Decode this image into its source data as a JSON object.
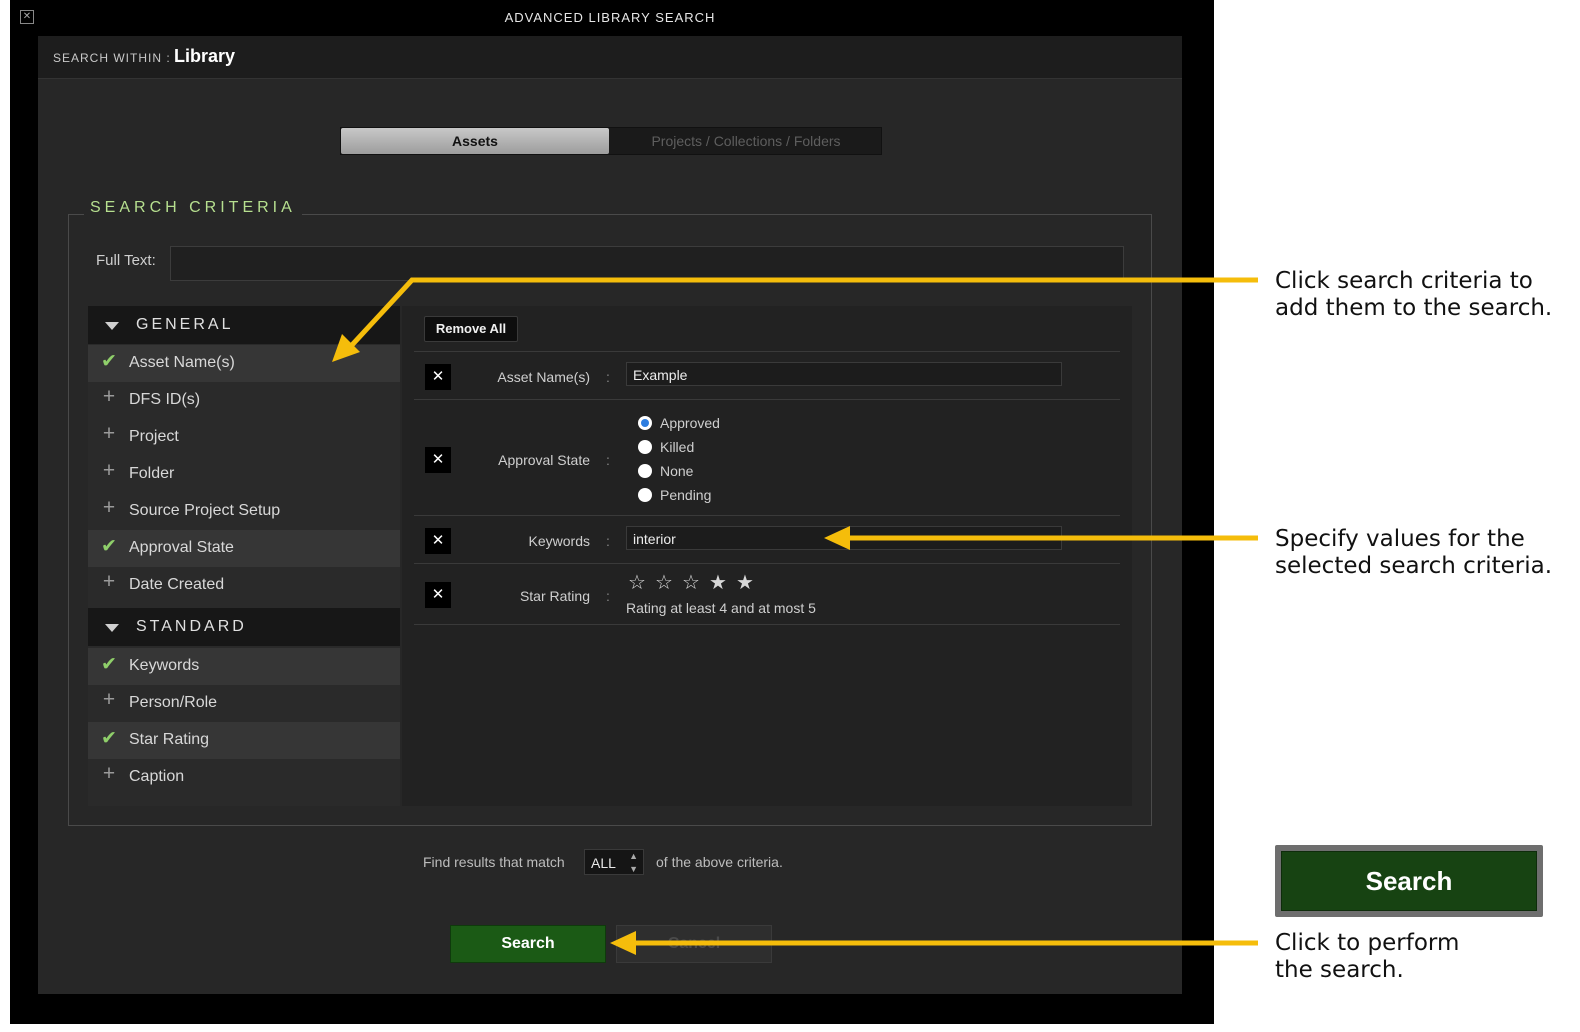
{
  "window": {
    "title": "ADVANCED LIBRARY SEARCH",
    "close_icon": "close-icon"
  },
  "search_within": {
    "label": "SEARCH WITHIN :",
    "value": "Library"
  },
  "tabs": [
    {
      "label": "Assets",
      "active": true
    },
    {
      "label": "Projects / Collections / Folders",
      "active": false
    }
  ],
  "criteria": {
    "title": "SEARCH CRITERIA",
    "full_text_label": "Full Text:",
    "full_text_value": "",
    "groups": [
      {
        "label": "GENERAL",
        "items": [
          {
            "label": "Asset Name(s)",
            "selected": true
          },
          {
            "label": "DFS ID(s)",
            "selected": false
          },
          {
            "label": "Project",
            "selected": false
          },
          {
            "label": "Folder",
            "selected": false
          },
          {
            "label": "Source Project Setup",
            "selected": false
          },
          {
            "label": "Approval State",
            "selected": true
          },
          {
            "label": "Date Created",
            "selected": false
          }
        ]
      },
      {
        "label": "STANDARD",
        "items": [
          {
            "label": "Keywords",
            "selected": true
          },
          {
            "label": "Person/Role",
            "selected": false
          },
          {
            "label": "Star Rating",
            "selected": true
          },
          {
            "label": "Caption",
            "selected": false
          }
        ]
      }
    ]
  },
  "selected_panel": {
    "remove_all": "Remove All",
    "remove_icon": "close-x-icon",
    "colon": ":",
    "rows": {
      "asset_name": {
        "label": "Asset Name(s)",
        "value": "Example"
      },
      "approval_state": {
        "label": "Approval State",
        "options": [
          "Approved",
          "Killed",
          "None",
          "Pending"
        ],
        "selected": "Approved"
      },
      "keywords": {
        "label": "Keywords",
        "value": "interior"
      },
      "star_rating": {
        "label": "Star Rating",
        "min": 4,
        "max": 5,
        "stars_total": 5,
        "text": "Rating at least 4 and at most 5"
      }
    }
  },
  "match": {
    "prefix": "Find results that match",
    "value": "ALL",
    "suffix": "of the above criteria."
  },
  "buttons": {
    "search": "Search",
    "cancel": "Cancel"
  },
  "annotations": {
    "criteria_note": "Click search criteria to\nadd them to the search.",
    "values_note": "Specify values for the\nselected search criteria.",
    "search_note": "Click to perform\nthe search.",
    "zoom_search": "Search",
    "arrow_color": "#f5bd0b"
  },
  "colors": {
    "accent_green": "#b6df8f",
    "check_green": "#8fcf6a",
    "search_green": "#1b5a15",
    "radio_blue": "#2d7de0"
  }
}
